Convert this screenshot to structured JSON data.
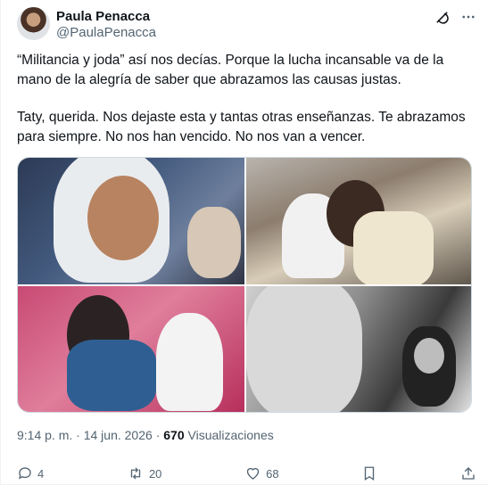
{
  "user": {
    "name": "Paula Penacca",
    "handle": "@PaulaPenacca"
  },
  "tweet": {
    "paragraph1": "“Militancia y joda” así nos decías. Porque la lucha incansable va de la mano de la alegría de saber que abrazamos las causas justas.",
    "paragraph2": "Taty, querida. Nos dejaste esta y tantas otras enseñanzas. Te abrazamos para siempre. No nos han vencido. No nos van a vencer."
  },
  "meta": {
    "time": "9:14 p. m.",
    "separator": "·",
    "date": "14 jun. 2026",
    "views_count": "670",
    "views_label": "Visualizaciones"
  },
  "actions": {
    "replies": "4",
    "reposts": "20",
    "likes": "68"
  },
  "icons": {
    "grok": "grok-icon",
    "more": "more-icon",
    "reply": "reply-icon",
    "repost": "repost-icon",
    "like": "heart-icon",
    "bookmark": "bookmark-icon",
    "share": "share-icon"
  },
  "colors": {
    "text": "#0f1419",
    "secondary": "#536471",
    "border": "#cfd9de"
  }
}
